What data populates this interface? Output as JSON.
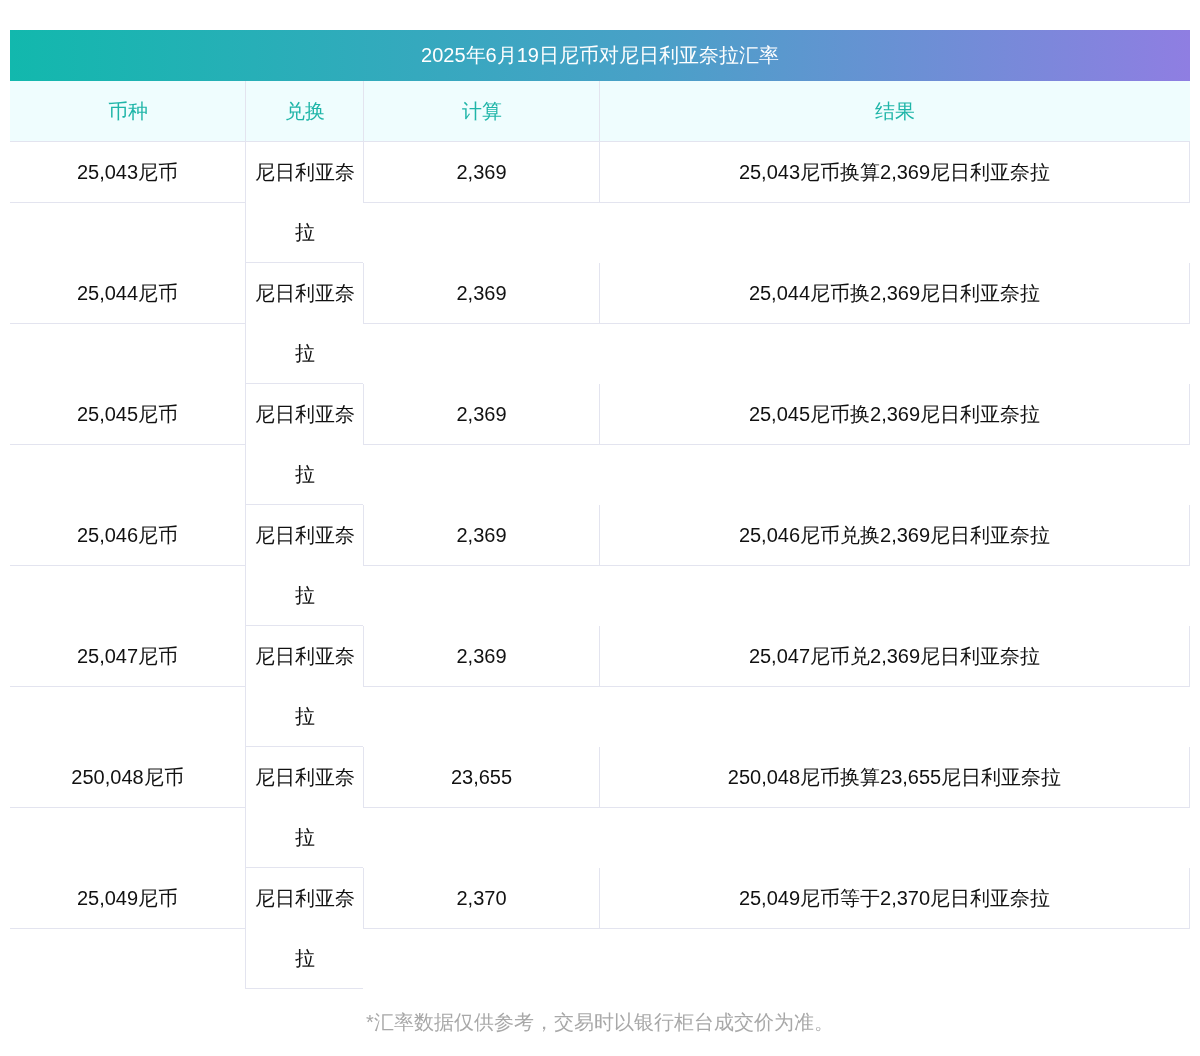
{
  "title": "2025年6月19日尼币对尼日利亚奈拉汇率",
  "columns": [
    "币种",
    "兑换",
    "计算",
    "结果"
  ],
  "rows": [
    {
      "currency": "25,043尼币",
      "target": "尼日利亚奈拉",
      "amount": "2,369",
      "result": "25,043尼币换算2,369尼日利亚奈拉"
    },
    {
      "currency": "25,044尼币",
      "target": "尼日利亚奈拉",
      "amount": "2,369",
      "result": "25,044尼币换2,369尼日利亚奈拉"
    },
    {
      "currency": "25,045尼币",
      "target": "尼日利亚奈拉",
      "amount": "2,369",
      "result": "25,045尼币换2,369尼日利亚奈拉"
    },
    {
      "currency": "25,046尼币",
      "target": "尼日利亚奈拉",
      "amount": "2,369",
      "result": "25,046尼币兑换2,369尼日利亚奈拉"
    },
    {
      "currency": "25,047尼币",
      "target": "尼日利亚奈拉",
      "amount": "2,369",
      "result": "25,047尼币兑2,369尼日利亚奈拉"
    },
    {
      "currency": "250,048尼币",
      "target": "尼日利亚奈拉",
      "amount": "23,655",
      "result": "250,048尼币换算23,655尼日利亚奈拉"
    },
    {
      "currency": "25,049尼币",
      "target": "尼日利亚奈拉",
      "amount": "2,370",
      "result": "25,049尼币等于2,370尼日利亚奈拉"
    }
  ],
  "note": "*汇率数据仅供参考，交易时以银行柜台成交价为准。"
}
